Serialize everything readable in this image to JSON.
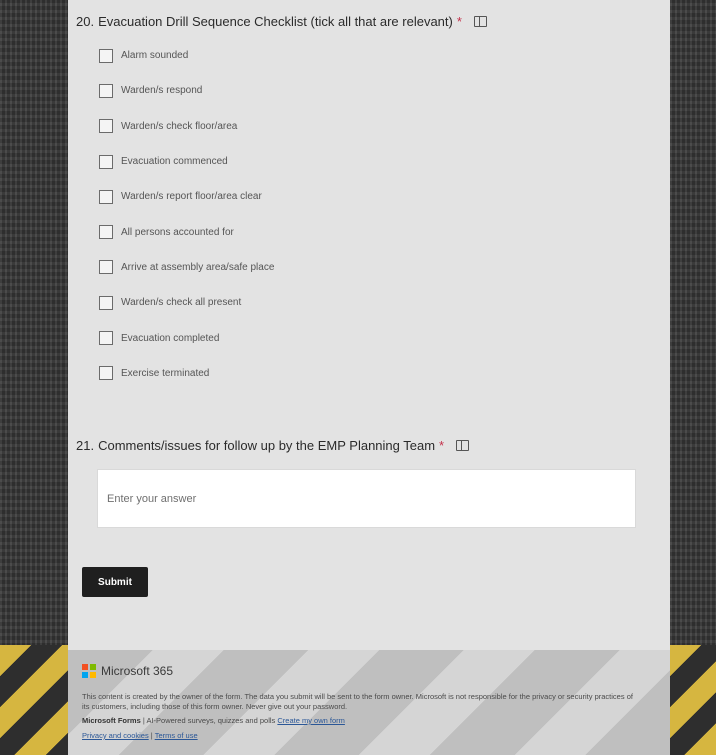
{
  "q20": {
    "number": "20.",
    "title": "Evacuation Drill Sequence Checklist (tick all that are relevant)",
    "required_mark": "*",
    "options": [
      "Alarm sounded",
      "Warden/s respond",
      "Warden/s check floor/area",
      "Evacuation commenced",
      "Warden/s report floor/area clear",
      "All persons accounted for",
      "Arrive at assembly area/safe place",
      "Warden/s check all present",
      "Evacuation completed",
      "Exercise terminated"
    ]
  },
  "q21": {
    "number": "21.",
    "title": "Comments/issues for follow up by the EMP Planning Team",
    "required_mark": "*",
    "placeholder": "Enter your answer"
  },
  "submit_label": "Submit",
  "footer": {
    "brand": "Microsoft 365",
    "disclaimer": "This content is created by the owner of the form. The data you submit will be sent to the form owner. Microsoft is not responsible for the privacy or security practices of its customers, including those of this form owner. Never give out your password.",
    "forms_name": "Microsoft Forms",
    "forms_tagline": " | AI-Powered surveys, quizzes and polls ",
    "create_link": "Create my own form",
    "privacy_link": "Privacy and cookies",
    "separator": " | ",
    "terms_link": "Terms of use"
  },
  "colors": {
    "required": "#c4314b",
    "submit_bg": "#1f1f1f",
    "hazard_yellow": "#d6b640"
  }
}
